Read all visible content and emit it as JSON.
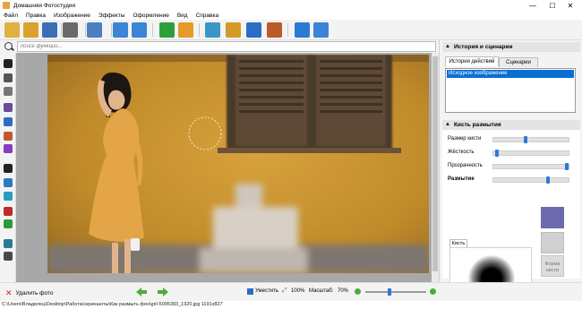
{
  "window": {
    "title": "Домашняя Фотостудия",
    "controls": {
      "minimize": "—",
      "maximize": "☐",
      "close": "✕"
    }
  },
  "menu": [
    "Файл",
    "Правка",
    "Изображение",
    "Эффекты",
    "Оформление",
    "Вид",
    "Справка"
  ],
  "toolbar": {
    "buttons": [
      {
        "name": "open-folder-icon",
        "color": "#e0b040"
      },
      {
        "name": "effects-disc-icon",
        "color": "#d9a12e"
      },
      {
        "name": "save-icon",
        "color": "#3a6fb5"
      },
      {
        "name": "print-icon",
        "color": "#6a6a6a"
      },
      {
        "name": "export-icon",
        "color": "#4a7fc0"
      },
      {
        "name": "undo-icon",
        "color": "#3b84d6"
      },
      {
        "name": "redo-icon",
        "color": "#3b84d6"
      },
      {
        "name": "text-icon",
        "color": "#2e9e3a"
      },
      {
        "name": "palette-icon",
        "color": "#e59a2a"
      },
      {
        "name": "frames-icon",
        "color": "#3a96c8"
      },
      {
        "name": "photo-icon",
        "color": "#d29a2a"
      },
      {
        "name": "calendar-icon",
        "color": "#2b6cc7"
      },
      {
        "name": "collage-icon",
        "color": "#b85a2a"
      },
      {
        "name": "help-icon",
        "color": "#2a7bd6"
      },
      {
        "name": "plugin-icon",
        "color": "#3b84d6"
      }
    ]
  },
  "search": {
    "placeholder": "поиск функций..."
  },
  "tools": [
    {
      "name": "pointer-tool-icon",
      "color": "#222222"
    },
    {
      "name": "crop-rotate-tool-icon",
      "color": "#555555"
    },
    {
      "name": "zoom-tool-icon",
      "color": "#777777"
    },
    {
      "name": "brush-tool-icon",
      "color": "#6b4b9a"
    },
    {
      "name": "blur-drop-tool-icon",
      "color": "#2f6bc0"
    },
    {
      "name": "stamp-tool-icon",
      "color": "#c05a2a"
    },
    {
      "name": "color-drop-tool-icon",
      "color": "#8a3ac0"
    },
    {
      "name": "contrast-tool-icon",
      "color": "#222222"
    },
    {
      "name": "eye-tool-icon",
      "color": "#2a7ac0"
    },
    {
      "name": "redeye-tool-icon",
      "color": "#2a9ac0"
    },
    {
      "name": "colors-tool-icon",
      "color": "#c02a2a"
    },
    {
      "name": "levels-tool-icon",
      "color": "#2a9a3a"
    },
    {
      "name": "rotate-tool-icon",
      "color": "#2a7a9a"
    },
    {
      "name": "crop-tool-icon",
      "color": "#4a4a4a"
    }
  ],
  "right_panel": {
    "history_section_title": "История и сценарии",
    "tabs": [
      "История действий",
      "Сценарии"
    ],
    "history_items": [
      "Исходное изображение"
    ],
    "blur_section_title": "Кисть размытия",
    "sliders": [
      {
        "label": "Размер кисти",
        "value": 0.42
      },
      {
        "label": "Жёсткость",
        "value": 0.02
      },
      {
        "label": "Прозрачность",
        "value": 0.98
      },
      {
        "label": "Размытие",
        "value": 0.72
      }
    ],
    "brush_tab": "Кисть",
    "form_button": "Форма кисти",
    "colors": {
      "swatch_primary": "#6e6aae",
      "swatch_secondary": "#d0d0d0",
      "accent": "#0a6fd4"
    }
  },
  "bottom": {
    "delete_label": "Удалить фото",
    "fit_label": "Уместить",
    "zoom_100": "100%",
    "scale_label": "Масштаб:",
    "scale_value": "70%"
  },
  "status": {
    "path": "C:\\Users\\Владелец\\Desktop\\Работа\\скриншоты\\Как размыть фон\\girl-5095383_1920.jpg 1191x827"
  }
}
